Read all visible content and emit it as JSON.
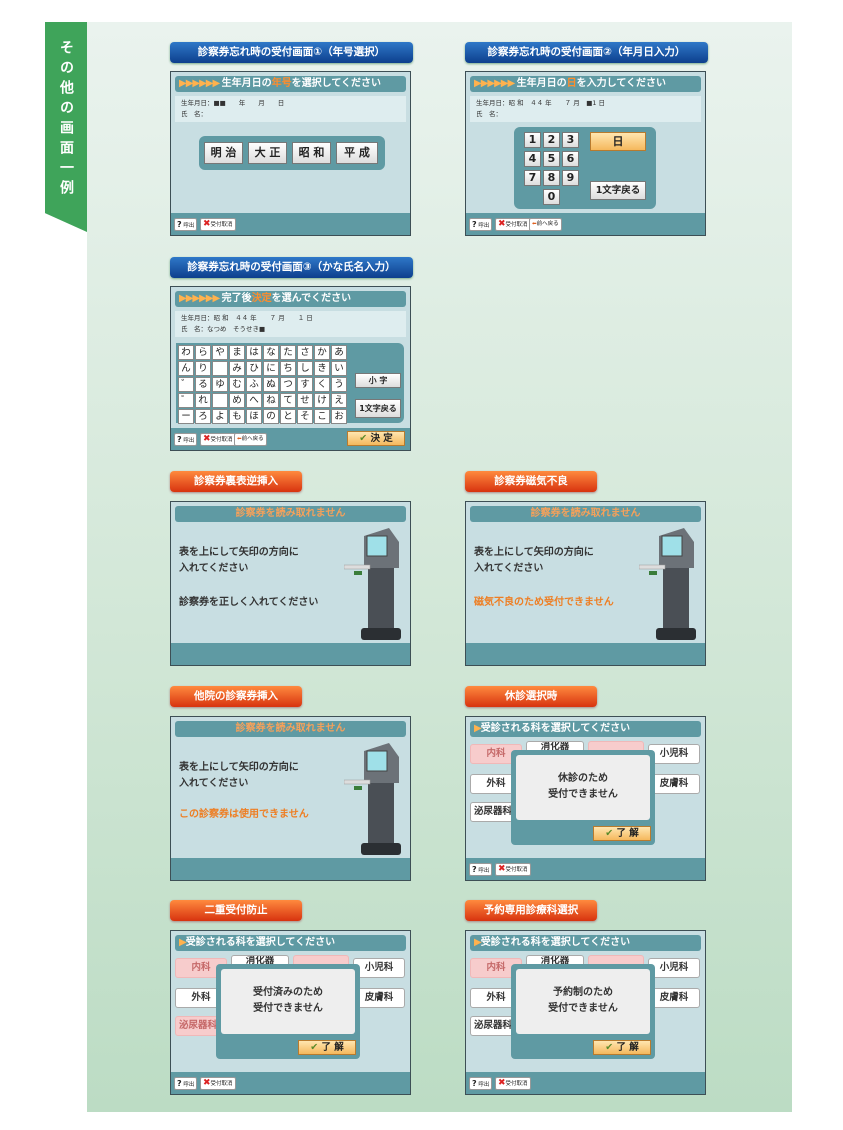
{
  "side_title": "その他の画面一例",
  "panels": {
    "p1": {
      "title": "診察券忘れ時の受付画面①（年号選択）",
      "header_prefix": "生年月日の",
      "header_highlight": "年号",
      "header_suffix": "を選択してください",
      "info_line1": "生年月日：■■　　年　　月　　日",
      "info_line2": "氏　名：",
      "eras": [
        "明 治",
        "大 正",
        "昭 和",
        "平 成"
      ]
    },
    "p2": {
      "title": "診察券忘れ時の受付画面②（年月日入力）",
      "header_prefix": "生年月日の",
      "header_highlight": "日",
      "header_suffix": "を入力してください",
      "info_line1": "生年月日：昭 和　４４ 年　　７ 月　■1 日",
      "info_line2": "氏　名：",
      "keys": [
        "1",
        "2",
        "3",
        "4",
        "5",
        "6",
        "7",
        "8",
        "9",
        "0"
      ],
      "day_button": "日",
      "back_button": "1文字戻る",
      "prev_button": "前へ戻る"
    },
    "p3": {
      "title": "診察券忘れ時の受付画面③（かな氏名入力）",
      "header_prefix": "完了後",
      "header_highlight": "決定",
      "header_suffix": "を選んでください",
      "info_line1": "生年月日：昭 和　４４ 年　　７ 月　　１ 日",
      "info_line2": "氏　名：なつめ　そうせき■",
      "kana": [
        "わ",
        "ら",
        "や",
        "ま",
        "は",
        "な",
        "た",
        "さ",
        "か",
        "あ",
        "ん",
        "り",
        "",
        "み",
        "ひ",
        "に",
        "ち",
        "し",
        "き",
        "い",
        "゛",
        "る",
        "ゆ",
        "む",
        "ふ",
        "ぬ",
        "つ",
        "す",
        "く",
        "う",
        "゜",
        "れ",
        "",
        "め",
        "へ",
        "ね",
        "て",
        "せ",
        "け",
        "え",
        "ー",
        "ろ",
        "よ",
        "も",
        "ほ",
        "の",
        "と",
        "そ",
        "こ",
        "お"
      ],
      "small_button": "小 字",
      "back_button": "1文字戻る",
      "prev_button": "前へ戻る",
      "decide_button": "決 定"
    },
    "p4": {
      "title": "診察券裏表逆挿入",
      "header": "診察券を読み取れません",
      "message1": "表を上にして矢印の方向に\n入れてください",
      "message2": "診察券を正しく入れてください"
    },
    "p5": {
      "title": "診察券磁気不良",
      "header": "診察券を読み取れません",
      "message1": "表を上にして矢印の方向に\n入れてください",
      "message2": "磁気不良のため受付できません"
    },
    "p6": {
      "title": "他院の診察券挿入",
      "header": "診察券を読み取れません",
      "message1": "表を上にして矢印の方向に\n入れてください",
      "message2": "この診察券は使用できません"
    },
    "p7": {
      "title": "休診選択時",
      "header": "受診される科を選択してください",
      "dialog": "休診のため\n受付できません",
      "ok": "了 解"
    },
    "p8": {
      "title": "二重受付防止",
      "header": "受診される科を選択してください",
      "dialog": "受付済みのため\n受付できません",
      "ok": "了 解"
    },
    "p9": {
      "title": "予約専用診療科選択",
      "header": "受診される科を選択してください",
      "dialog": "予約制のため\n受付できません",
      "ok": "了 解"
    }
  },
  "departments": [
    "内科",
    "消化器",
    "小児科",
    "外科",
    "皮膚科",
    "泌尿器科"
  ],
  "footer": {
    "call": "呼出",
    "cancel": "受付取消"
  },
  "colors": {
    "side_tab": "#3fa45a",
    "title_blue": "#1a55a8",
    "title_red": "#e9461a",
    "screen_teal": "#5f9aa3",
    "highlight_orange": "#ee7e23"
  }
}
